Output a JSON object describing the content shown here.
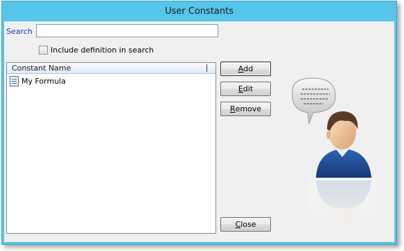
{
  "window": {
    "title": "User Constants"
  },
  "search": {
    "label": "Search",
    "value": "",
    "placeholder": ""
  },
  "include_definition": {
    "label": "Include definition in search",
    "checked": false
  },
  "list": {
    "columns": [
      "Constant Name"
    ],
    "rows": [
      {
        "name": "My Formula",
        "icon": "formula-document-icon"
      }
    ]
  },
  "buttons": {
    "add": {
      "mnemonic": "A",
      "rest": "dd"
    },
    "edit": {
      "mnemonic": "E",
      "rest": "dit"
    },
    "remove": {
      "mnemonic": "R",
      "rest": "emove"
    },
    "close": {
      "mnemonic": "C",
      "rest": "lose"
    }
  },
  "illustration": {
    "icon": "user-speech-bubble-icon"
  },
  "colors": {
    "title_bar": "#56c5ea",
    "search_label": "#1a3fb5",
    "client_bg": "#f0f0f0"
  }
}
